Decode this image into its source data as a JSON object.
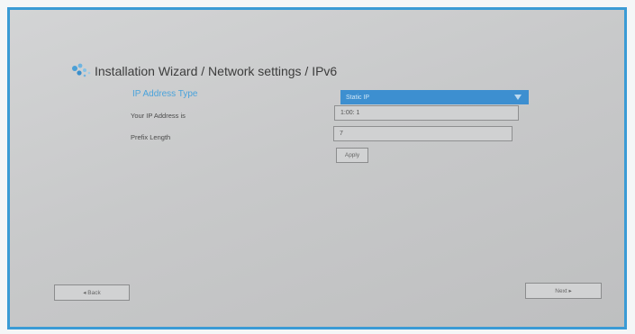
{
  "header": {
    "title": "Installation Wizard / Network settings / IPv6"
  },
  "form": {
    "ip_type_label": "IP Address Type",
    "ip_type_value": "Static IP",
    "ip_address_label": "Your IP Address is",
    "ip_address_value": "1:00: 1",
    "prefix_length_label": "Prefix Length",
    "prefix_length_value": "7",
    "apply_label": "Apply"
  },
  "footer": {
    "back_label": "◂ Back",
    "next_label": "Next ▸"
  },
  "colors": {
    "accent": "#3d8fd0",
    "frame_border": "#3a9bd5"
  }
}
